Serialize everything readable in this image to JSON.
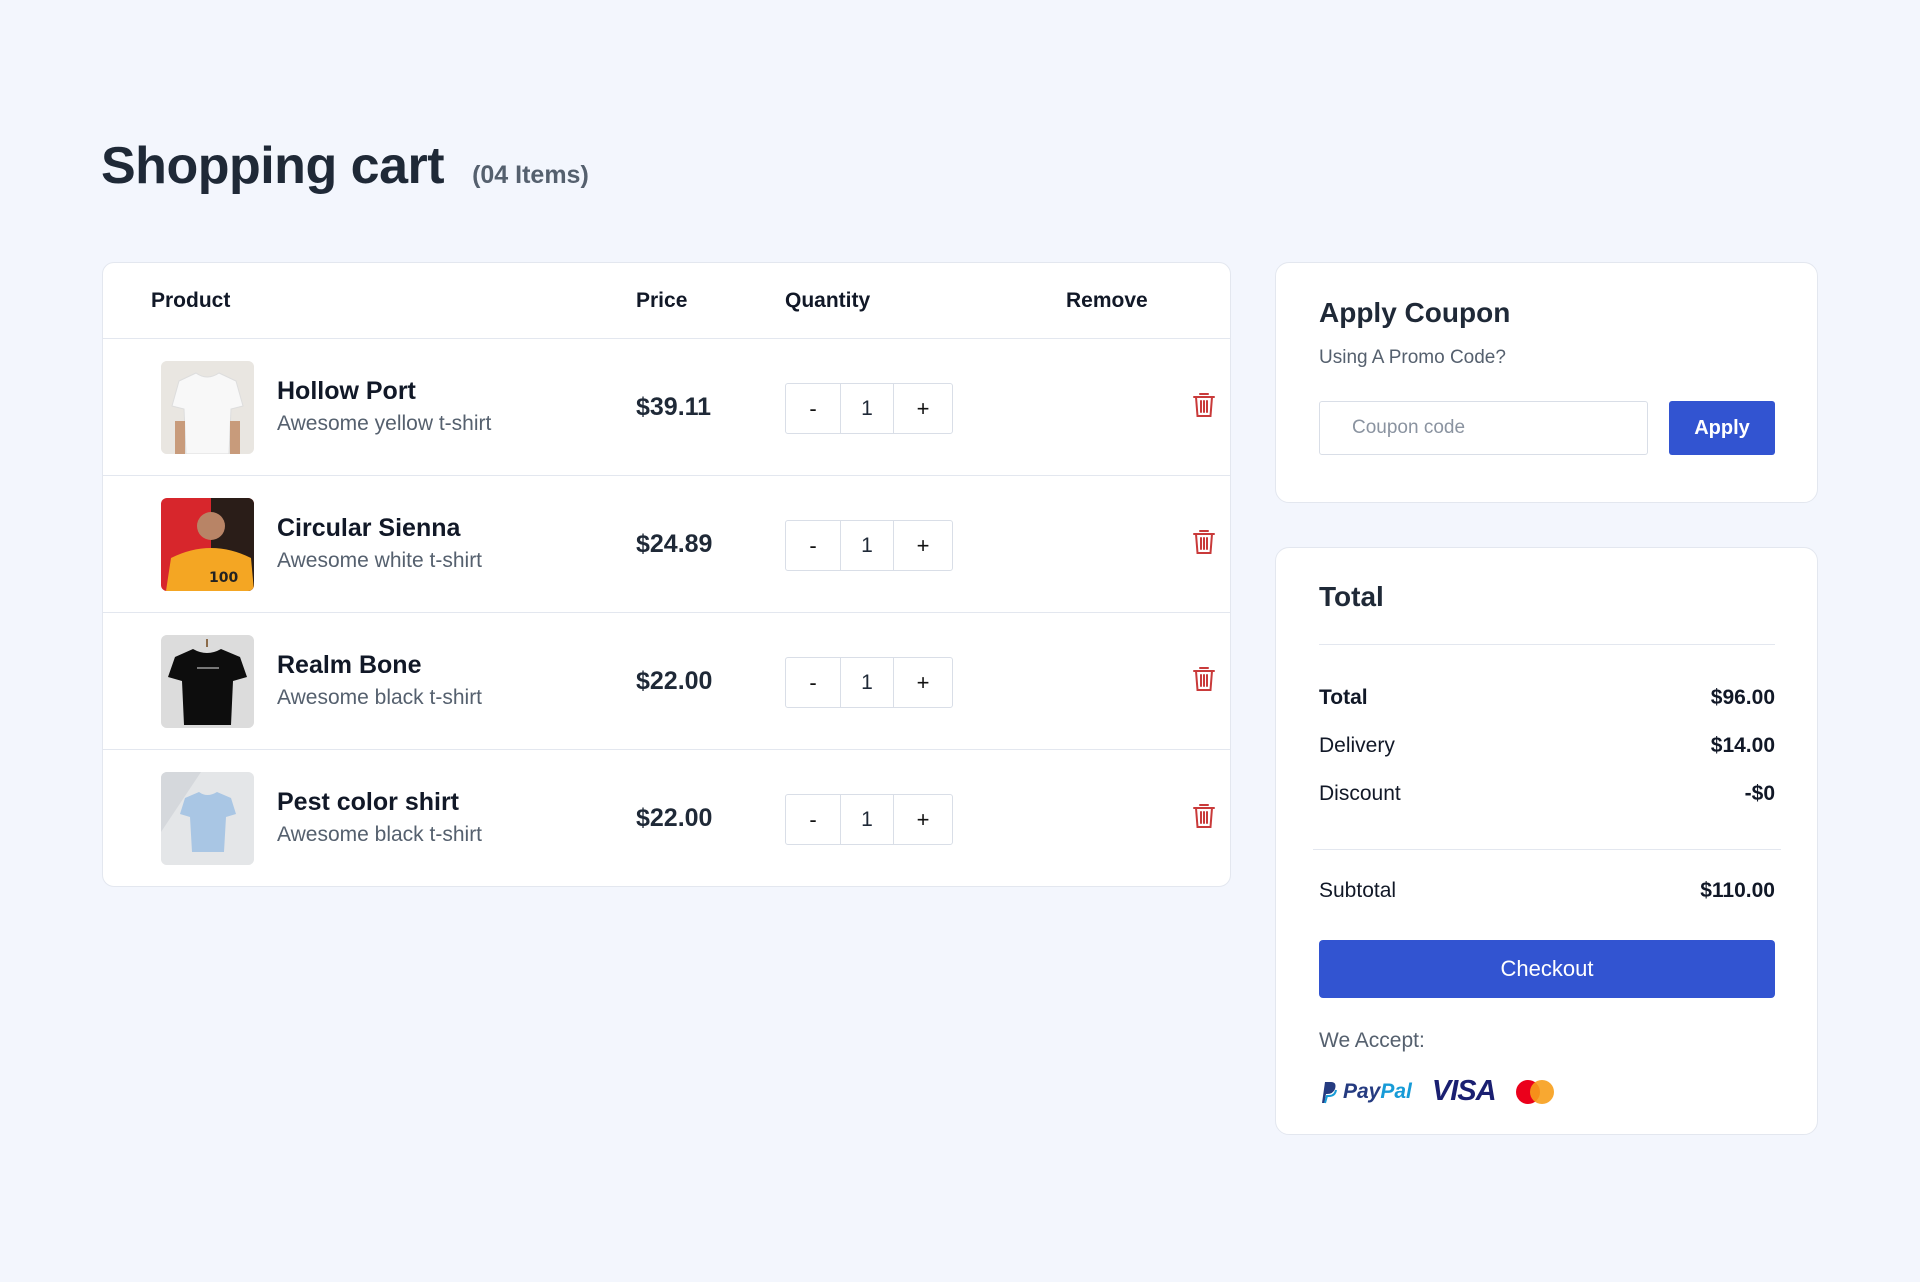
{
  "header": {
    "title": "Shopping cart",
    "item_count": "(04 Items)"
  },
  "cart": {
    "columns": {
      "product": "Product",
      "price": "Price",
      "quantity": "Quantity",
      "remove": "Remove"
    },
    "items": [
      {
        "name": "Hollow Port",
        "description": "Awesome yellow t-shirt",
        "price": "$39.11",
        "quantity": "1",
        "thumb_color": "#f2f2f2"
      },
      {
        "name": "Circular Sienna",
        "description": "Awesome white t-shirt",
        "price": "$24.89",
        "quantity": "1",
        "thumb_color": "#f4a623"
      },
      {
        "name": "Realm Bone",
        "description": "Awesome black t-shirt",
        "price": "$22.00",
        "quantity": "1",
        "thumb_color": "#111111"
      },
      {
        "name": "Pest color shirt",
        "description": "Awesome black t-shirt",
        "price": "$22.00",
        "quantity": "1",
        "thumb_color": "#a9c6e4"
      }
    ],
    "stepper": {
      "minus": "-",
      "plus": "+"
    }
  },
  "coupon": {
    "title": "Apply Coupon",
    "subtitle": "Using A Promo Code?",
    "placeholder": "Coupon code",
    "apply_label": "Apply"
  },
  "summary": {
    "title": "Total",
    "rows": [
      {
        "label": "Total",
        "value": "$96.00"
      },
      {
        "label": "Delivery",
        "value": "$14.00"
      },
      {
        "label": "Discount",
        "value": "-$0"
      }
    ],
    "subtotal": {
      "label": "Subtotal",
      "value": "$110.00"
    },
    "checkout_label": "Checkout",
    "accept_label": "We Accept:",
    "payment_logos": {
      "paypal_a": "Pay",
      "paypal_b": "Pal",
      "visa": "VISA"
    }
  },
  "colors": {
    "accent": "#3254d1",
    "danger": "#c93a3a",
    "background": "#f3f6fd"
  }
}
